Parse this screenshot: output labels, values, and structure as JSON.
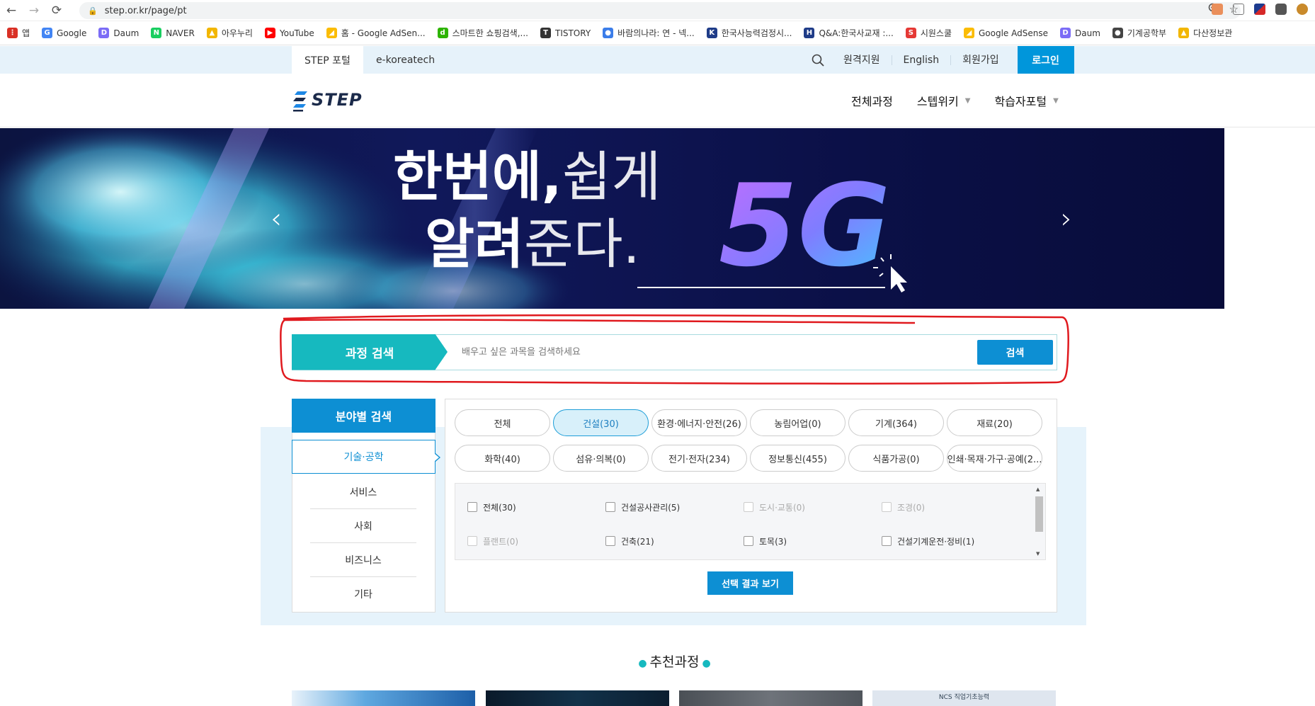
{
  "browser": {
    "url": "step.or.kr/page/pt",
    "bookmarks": [
      {
        "label": "앱",
        "color": "#d93025",
        "glyph": "⋮"
      },
      {
        "label": "Google",
        "color": "#4285f4",
        "glyph": "G"
      },
      {
        "label": "Daum",
        "color": "#7b6cf6",
        "glyph": "D"
      },
      {
        "label": "NAVER",
        "color": "#19ce60",
        "glyph": "N"
      },
      {
        "label": "아우누리",
        "color": "#f2b600",
        "glyph": "▲"
      },
      {
        "label": "YouTube",
        "color": "#ff0000",
        "glyph": "▶"
      },
      {
        "label": "홈 - Google AdSen...",
        "color": "#fbbc04",
        "glyph": "◢"
      },
      {
        "label": "스마트한 쇼핑검색,...",
        "color": "#2db400",
        "glyph": "d"
      },
      {
        "label": "TISTORY",
        "color": "#333333",
        "glyph": "T"
      },
      {
        "label": "바람의나라: 연 - 넥...",
        "color": "#3b7de9",
        "glyph": "●"
      },
      {
        "label": "한국사능력검정시...",
        "color": "#1f3c88",
        "glyph": "K"
      },
      {
        "label": "Q&A:한국사교재 :...",
        "color": "#1f3c88",
        "glyph": "H"
      },
      {
        "label": "시원스쿨",
        "color": "#e53935",
        "glyph": "S"
      },
      {
        "label": "Google AdSense",
        "color": "#fbbc04",
        "glyph": "◢"
      },
      {
        "label": "Daum",
        "color": "#7b6cf6",
        "glyph": "D"
      },
      {
        "label": "기계공학부",
        "color": "#444444",
        "glyph": "●"
      },
      {
        "label": "다산정보관",
        "color": "#f2b600",
        "glyph": "▲"
      }
    ]
  },
  "topbar": {
    "tabs": [
      "STEP 포털",
      "e-koreatech"
    ],
    "links": [
      "원격지원",
      "English",
      "회원가입"
    ],
    "login_label": "로그인"
  },
  "header": {
    "logo_text": "STEP",
    "nav": [
      "전체과정",
      "스텝위키",
      "학습자포털"
    ]
  },
  "hero": {
    "line1_bold": "한번에,",
    "line1_thin": "쉽게",
    "line2_bold": "알려",
    "line2_thin": "준다.",
    "badge": "5G"
  },
  "course_search": {
    "label": "과정 검색",
    "placeholder": "배우고 싶은 과목을 검색하세요",
    "button": "검색"
  },
  "field_search": {
    "title": "분야별 검색",
    "categories": [
      "기술·공학",
      "서비스",
      "사회",
      "비즈니스",
      "기타"
    ],
    "active_category": "기술·공학",
    "pills": [
      "전체",
      "건설(30)",
      "환경·에너지·안전(26)",
      "농림어업(0)",
      "기계(364)",
      "재료(20)",
      "화학(40)",
      "섬유·의복(0)",
      "전기·전자(234)",
      "정보통신(455)",
      "식품가공(0)",
      "인쇄·목재·가구·공예(2..."
    ],
    "active_pill": "건설(30)",
    "subfields": [
      {
        "label": "전체(30)",
        "disabled": false
      },
      {
        "label": "건설공사관리(5)",
        "disabled": false
      },
      {
        "label": "도시·교통(0)",
        "disabled": true
      },
      {
        "label": "조경(0)",
        "disabled": true
      },
      {
        "label": "플랜트(0)",
        "disabled": true
      },
      {
        "label": "건축(21)",
        "disabled": false
      },
      {
        "label": "토목(3)",
        "disabled": false
      },
      {
        "label": "건설기계운전·정비(1)",
        "disabled": false
      }
    ],
    "view_button": "선택 결과 보기"
  },
  "recommended": {
    "title": "추천과정",
    "thumb_caption": "NCS 직업기초능력"
  },
  "colors": {
    "accent_teal": "#16b9bf",
    "accent_blue": "#0d8fd3",
    "annotation_red": "#e0191e"
  }
}
